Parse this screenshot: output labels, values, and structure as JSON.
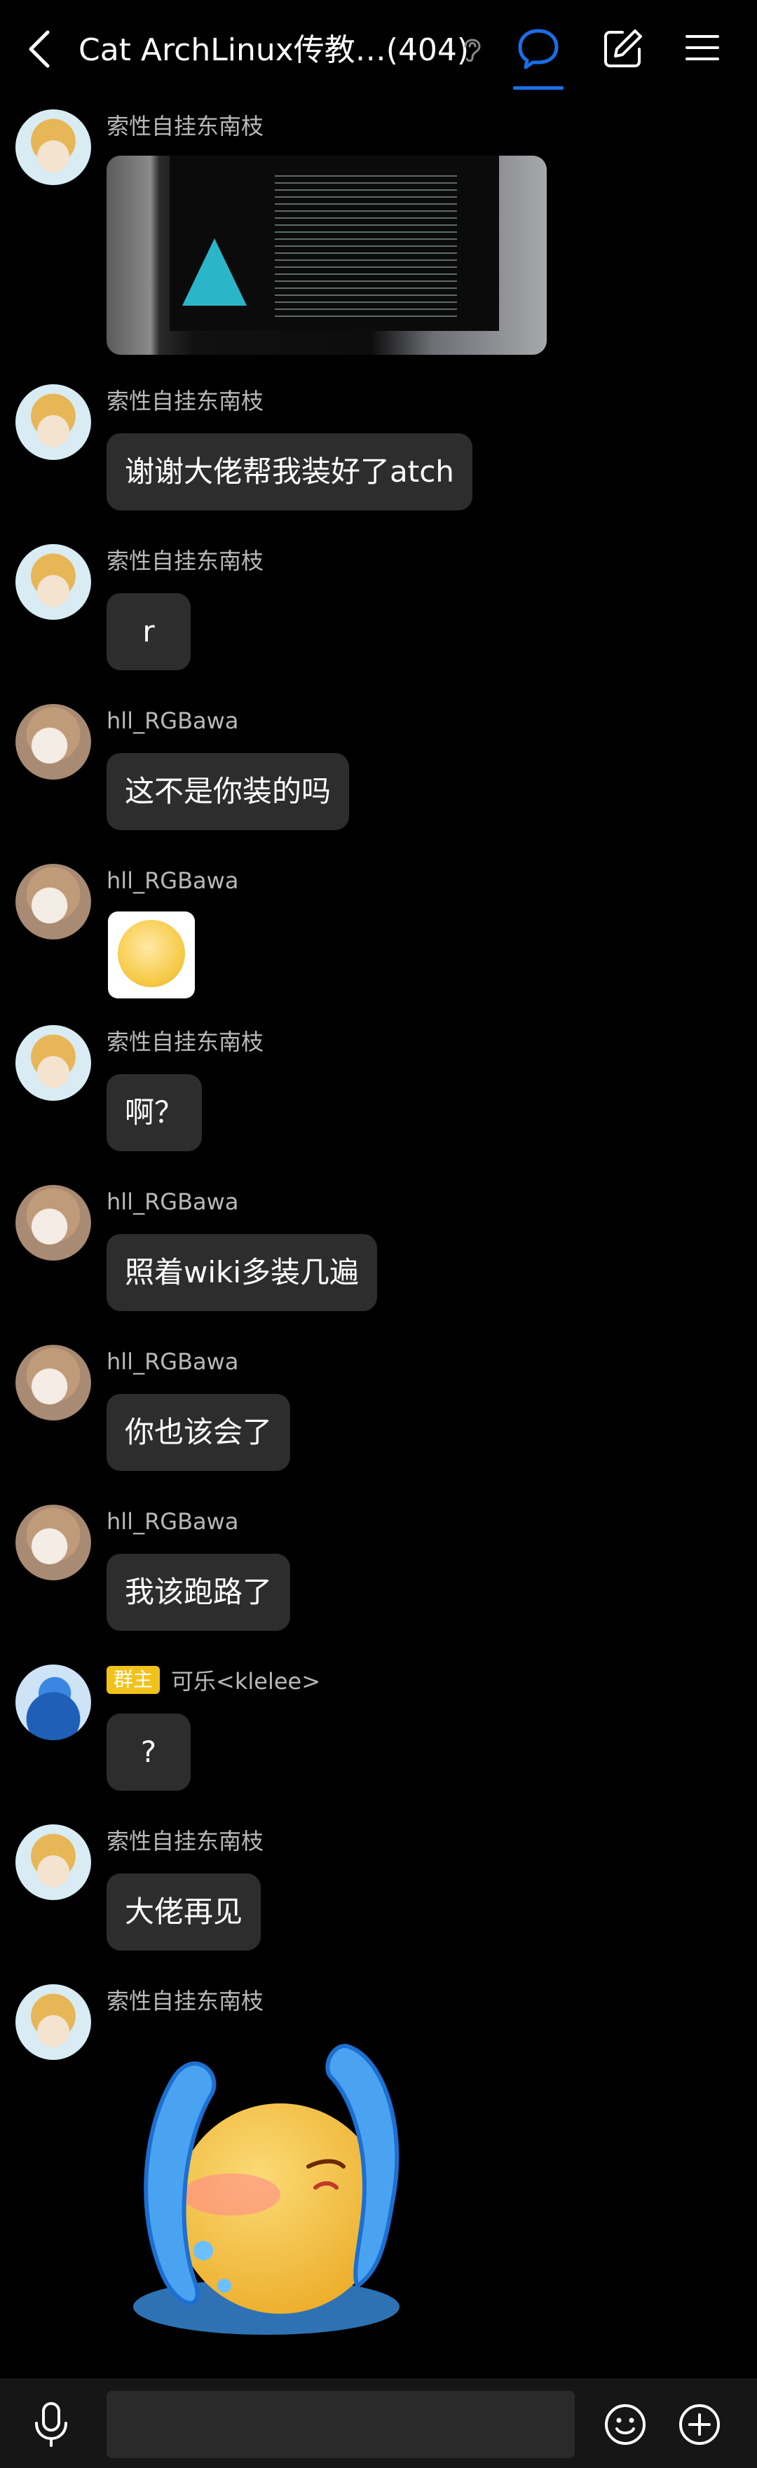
{
  "header": {
    "title": "Cat ArchLinux传教…(404)"
  },
  "senders": {
    "a": "索性自挂东南枝",
    "b": "hll_RGBawa",
    "c": "可乐<klelee>",
    "c_badge": "群主"
  },
  "messages": [
    {
      "sender": "索性自挂东南枝",
      "type": "image"
    },
    {
      "sender": "索性自挂东南枝",
      "text": "谢谢大佬帮我装好了atch"
    },
    {
      "sender": "索性自挂东南枝",
      "text": "r"
    },
    {
      "sender": "hll_RGBawa",
      "text": "这不是你装的吗"
    },
    {
      "sender": "hll_RGBawa",
      "type": "sticker"
    },
    {
      "sender": "索性自挂东南枝",
      "text": "啊？"
    },
    {
      "sender": "hll_RGBawa",
      "text": "照着wiki多装几遍"
    },
    {
      "sender": "hll_RGBawa",
      "text": "你也该会了"
    },
    {
      "sender": "hll_RGBawa",
      "text": "我该跑路了"
    },
    {
      "sender": "可乐<klelee>",
      "badge": "群主",
      "text": "?"
    },
    {
      "sender": "索性自挂东南枝",
      "text": "大佬再见"
    },
    {
      "sender": "索性自挂东南枝",
      "type": "sticker"
    }
  ],
  "input": {
    "placeholder": ""
  },
  "colors": {
    "background": "#000000",
    "bubble": "#2d2d2d",
    "accent": "#1a6ee8",
    "badge": "#f2c21c"
  },
  "icons": [
    "back-icon",
    "ear-icon",
    "chat-icon",
    "edit-icon",
    "menu-icon",
    "mic-icon",
    "emoji-icon",
    "plus-icon"
  ]
}
